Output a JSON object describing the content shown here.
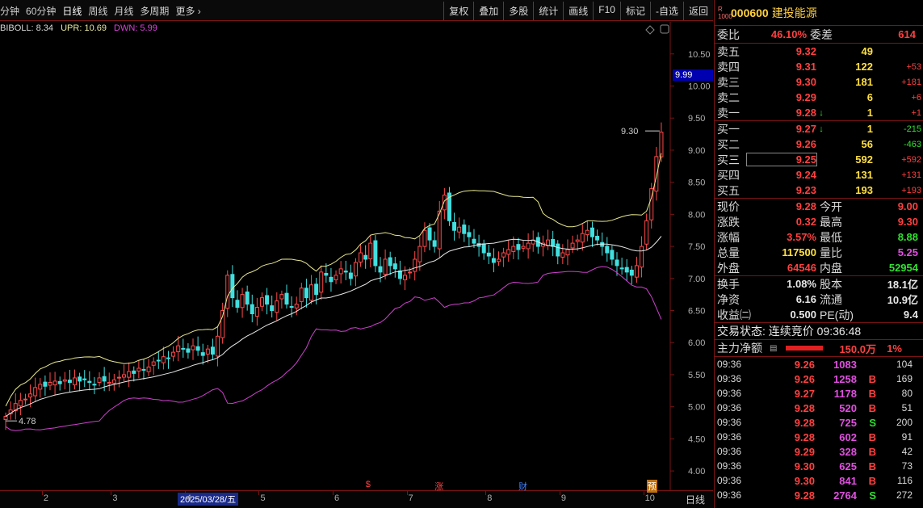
{
  "toolbar": {
    "periods": [
      "分钟",
      "60分钟",
      "日线",
      "周线",
      "月线",
      "多周期",
      "更多"
    ],
    "tools": [
      "复权",
      "叠加",
      "多股",
      "统计",
      "画线",
      "F10",
      "标记",
      "-自选",
      "返回"
    ]
  },
  "indicator": {
    "name": "BIBOLL: 8.34",
    "upr": "UPR: 10.69",
    "dwn": "DWN: 5.99"
  },
  "price_tag": "9.99",
  "chart_annotations": {
    "high_label": "9.30",
    "low_label": "4.78"
  },
  "event_markers": [
    "$",
    "涨",
    "财",
    "预"
  ],
  "date_axis": {
    "cursor_date": "2025/03/28/五",
    "period": "日线"
  },
  "chart_data": {
    "type": "candlestick",
    "y_ticks": [
      10.5,
      10.0,
      9.5,
      9.0,
      8.5,
      8.0,
      7.5,
      7.0,
      6.5,
      6.0,
      5.5,
      5.0,
      4.5,
      4.0
    ],
    "x_ticks": [
      "2",
      "3",
      "4",
      "5",
      "6",
      "7",
      "8",
      "9",
      "10"
    ],
    "ylim": [
      3.8,
      10.9
    ],
    "x_tick_idx": [
      8,
      22,
      37,
      52,
      67,
      82,
      98,
      113,
      130
    ],
    "marker_idx": [
      74,
      88,
      105,
      131
    ],
    "close": [
      4.85,
      4.95,
      5.05,
      5.1,
      5.12,
      5.2,
      5.3,
      5.35,
      5.32,
      5.38,
      5.4,
      5.36,
      5.42,
      5.38,
      5.45,
      5.4,
      5.42,
      5.38,
      5.35,
      5.45,
      5.4,
      5.38,
      5.42,
      5.46,
      5.5,
      5.55,
      5.52,
      5.6,
      5.58,
      5.62,
      5.7,
      5.72,
      5.78,
      5.75,
      5.85,
      5.95,
      5.9,
      5.85,
      5.95,
      5.88,
      5.8,
      5.9,
      5.82,
      6.1,
      6.5,
      7.05,
      6.7,
      6.55,
      6.75,
      6.6,
      6.45,
      6.55,
      6.7,
      6.6,
      6.5,
      6.65,
      6.75,
      6.6,
      6.55,
      6.6,
      6.85,
      6.7,
      6.9,
      6.75,
      7.1,
      7.05,
      6.95,
      7.05,
      7.15,
      7.1,
      7.0,
      7.25,
      7.4,
      7.3,
      7.55,
      7.2,
      7.1,
      7.3,
      7.2,
      7.15,
      7.0,
      7.05,
      7.1,
      7.3,
      7.5,
      7.75,
      7.6,
      7.5,
      8.05,
      8.3,
      7.9,
      7.75,
      7.8,
      7.7,
      7.65,
      7.55,
      7.5,
      7.4,
      7.35,
      7.25,
      7.3,
      7.4,
      7.45,
      7.5,
      7.45,
      7.5,
      7.55,
      7.6,
      7.5,
      7.55,
      7.6,
      7.5,
      7.35,
      7.4,
      7.45,
      7.55,
      7.6,
      7.7,
      7.75,
      7.65,
      7.6,
      7.5,
      7.4,
      7.3,
      7.2,
      7.15,
      7.1,
      7.05,
      7.2,
      7.5,
      7.9,
      8.4,
      8.9,
      9.28
    ]
  },
  "quote": {
    "badge": "R 1000",
    "code": "000600",
    "name": "建投能源",
    "weibi_label": "委比",
    "weibi": "46.10%",
    "weicha_label": "委差",
    "weicha": "614",
    "asks": [
      {
        "label": "卖五",
        "price": "9.32",
        "vol": "49",
        "chg": "",
        "arrow": ""
      },
      {
        "label": "卖四",
        "price": "9.31",
        "vol": "122",
        "chg": "+53",
        "arrow": ""
      },
      {
        "label": "卖三",
        "price": "9.30",
        "vol": "181",
        "chg": "+181",
        "arrow": ""
      },
      {
        "label": "卖二",
        "price": "9.29",
        "vol": "6",
        "chg": "+6",
        "arrow": ""
      },
      {
        "label": "卖一",
        "price": "9.28",
        "vol": "1",
        "chg": "+1",
        "arrow": "↓"
      }
    ],
    "bids": [
      {
        "label": "买一",
        "price": "9.27",
        "vol": "1",
        "chg": "-215",
        "arrow": "↓"
      },
      {
        "label": "买二",
        "price": "9.26",
        "vol": "56",
        "chg": "-463",
        "arrow": ""
      },
      {
        "label": "买三",
        "price": "9.25",
        "vol": "592",
        "chg": "+592",
        "arrow": ""
      },
      {
        "label": "买四",
        "price": "9.24",
        "vol": "131",
        "chg": "+131",
        "arrow": ""
      },
      {
        "label": "买五",
        "price": "9.23",
        "vol": "193",
        "chg": "+193",
        "arrow": ""
      }
    ],
    "stats1": [
      {
        "k1": "现价",
        "v1": "9.28",
        "k2": "今开",
        "v2": "9.00",
        "c1": "red",
        "c2": "red"
      },
      {
        "k1": "涨跌",
        "v1": "0.32",
        "k2": "最高",
        "v2": "9.30",
        "c1": "red",
        "c2": "red"
      },
      {
        "k1": "涨幅",
        "v1": "3.57%",
        "k2": "最低",
        "v2": "8.88",
        "c1": "red",
        "c2": "green"
      },
      {
        "k1": "总量",
        "v1": "117500",
        "k2": "量比",
        "v2": "5.25",
        "c1": "yellow",
        "c2": "magenta"
      },
      {
        "k1": "外盘",
        "v1": "64546",
        "k2": "内盘",
        "v2": "52954",
        "c1": "red",
        "c2": "green"
      }
    ],
    "stats2": [
      {
        "k1": "换手",
        "v1": "1.08%",
        "k2": "股本",
        "v2": "18.1亿"
      },
      {
        "k1": "净资",
        "v1": "6.16",
        "k2": "流通",
        "v2": "10.9亿"
      },
      {
        "k1": "收益㈡",
        "v1": "0.500",
        "k2": "PE(动)",
        "v2": "9.4"
      }
    ],
    "status": "交易状态: 连续竞价 09:36:48",
    "main_flow_label": "主力净额",
    "main_flow_value": "150.0万",
    "main_flow_pct": "1%",
    "trades": [
      {
        "t": "09:36",
        "p": "9.26",
        "v": "1083",
        "bs": "",
        "n": "104"
      },
      {
        "t": "09:36",
        "p": "9.26",
        "v": "1258",
        "bs": "B",
        "n": "169"
      },
      {
        "t": "09:36",
        "p": "9.27",
        "v": "1178",
        "bs": "B",
        "n": "80"
      },
      {
        "t": "09:36",
        "p": "9.28",
        "v": "520",
        "bs": "B",
        "n": "51"
      },
      {
        "t": "09:36",
        "p": "9.28",
        "v": "725",
        "bs": "S",
        "n": "200"
      },
      {
        "t": "09:36",
        "p": "9.28",
        "v": "602",
        "bs": "B",
        "n": "91"
      },
      {
        "t": "09:36",
        "p": "9.29",
        "v": "328",
        "bs": "B",
        "n": "42"
      },
      {
        "t": "09:36",
        "p": "9.30",
        "v": "625",
        "bs": "B",
        "n": "73"
      },
      {
        "t": "09:36",
        "p": "9.30",
        "v": "841",
        "bs": "B",
        "n": "116"
      },
      {
        "t": "09:36",
        "p": "9.28",
        "v": "2764",
        "bs": "S",
        "n": "272"
      }
    ]
  }
}
